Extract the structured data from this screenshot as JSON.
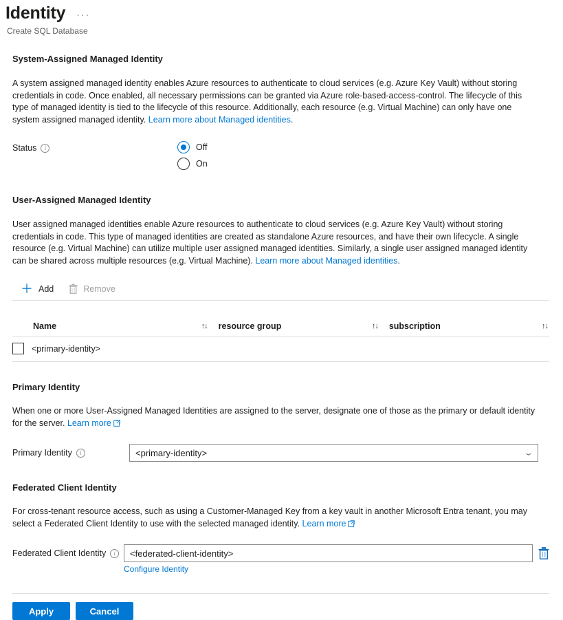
{
  "header": {
    "title": "Identity",
    "more_menu": "···",
    "subtitle": "Create SQL Database"
  },
  "system_assigned": {
    "heading": "System-Assigned Managed Identity",
    "description": "A system assigned managed identity enables Azure resources to authenticate to cloud services (e.g. Azure Key Vault) without storing credentials in code. Once enabled, all necessary permissions can be granted via Azure role-based-access-control. The lifecycle of this type of managed identity is tied to the lifecycle of this resource. Additionally, each resource (e.g. Virtual Machine) can only have one system assigned managed identity. ",
    "learn_more": "Learn more about Managed identities",
    "description_end": ".",
    "status_label": "Status",
    "info_glyph": "i",
    "options": [
      {
        "label": "Off",
        "selected": true
      },
      {
        "label": "On",
        "selected": false
      }
    ]
  },
  "user_assigned": {
    "heading": "User-Assigned Managed Identity",
    "description": "User assigned managed identities enable Azure resources to authenticate to cloud services (e.g. Azure Key Vault) without storing credentials in code. This type of managed identities are created as standalone Azure resources, and have their own lifecycle. A single resource (e.g. Virtual Machine) can utilize multiple user assigned managed identities. Similarly, a single user assigned managed identity can be shared across multiple resources (e.g. Virtual Machine). ",
    "learn_more": "Learn more about Managed identities",
    "description_end": ".",
    "toolbar": {
      "add_label": "Add",
      "add_icon": "plus-icon",
      "remove_label": "Remove",
      "remove_icon": "trash-icon",
      "remove_disabled": true
    },
    "table": {
      "columns": [
        {
          "label": "Name",
          "sort_icon": "↑↓"
        },
        {
          "label": "resource group",
          "sort_icon": "↑↓"
        },
        {
          "label": "subscription",
          "sort_icon": "↑↓"
        }
      ],
      "rows": [
        {
          "checked": false,
          "name": "<primary-identity>",
          "resource_group": "",
          "subscription": ""
        }
      ]
    }
  },
  "primary_identity": {
    "heading": "Primary Identity",
    "description": "When one or more User-Assigned Managed Identities are assigned to the server, designate one of those as the primary or default identity for the server. ",
    "learn_more": "Learn more",
    "field_label": "Primary Identity",
    "info_glyph": "i",
    "selected_value": "<primary-identity>",
    "chevron": "⌄"
  },
  "federated_client_identity": {
    "heading": "Federated Client Identity",
    "description": "For cross-tenant resource access, such as using a Customer-Managed Key from a key vault in another Microsoft Entra tenant, you may select a Federated Client Identity to use with the selected managed identity. ",
    "learn_more": "Learn more",
    "field_label": "Federated Client Identity",
    "info_glyph": "i",
    "value": "<federated-client-identity>",
    "delete_icon": "trash-icon",
    "configure_link": "Configure Identity"
  },
  "footer": {
    "apply_label": "Apply",
    "cancel_label": "Cancel"
  },
  "colors": {
    "accent": "#0078d4",
    "link": "#0078d4",
    "text": "#201f1e",
    "muted": "#605e5c",
    "disabled": "#a19f9d",
    "divider": "#e1dfdd",
    "border": "#8a8886"
  }
}
